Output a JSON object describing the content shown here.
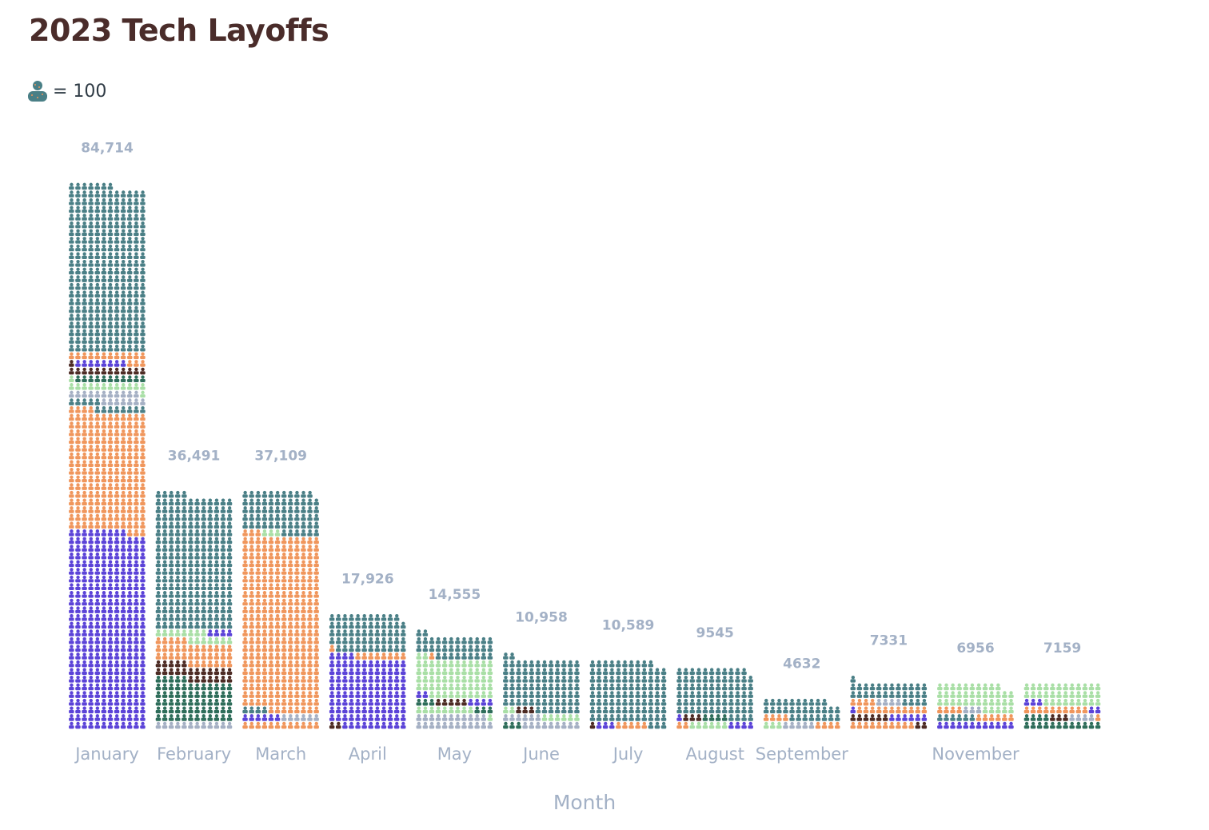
{
  "chart_data": {
    "type": "bar",
    "subtype": "isotype-stacked-pictogram",
    "title": "2023 Tech Layoffs",
    "legend": {
      "icon": "person-icon",
      "text": "= 100",
      "unit_value": 100,
      "placement": "top-left"
    },
    "xlabel": "Month",
    "ylabel": "",
    "grid": false,
    "tick_labels": [
      "January",
      "February",
      "March",
      "April",
      "May",
      "June",
      "July",
      "August",
      "September",
      "",
      "November",
      ""
    ],
    "values": [
      84714,
      36491,
      37109,
      17926,
      14555,
      10958,
      10589,
      9545,
      4632,
      7331,
      6956,
      7159
    ],
    "value_labels": [
      "84,714",
      "36,491",
      "37,109",
      "17,926",
      "14,555",
      "10,958",
      "10,589",
      "9545",
      "4632",
      "7331",
      "6956",
      "7159"
    ],
    "colors": {
      "teal": "#4a7f86",
      "orange": "#f0965c",
      "purple": "#5b43d8",
      "green": "#a9dfa6",
      "gray": "#a5b0c4",
      "brown": "#4d2b24",
      "darkgreen": "#2e6d5a"
    },
    "segments": [
      [
        [
          "purple",
          30900
        ],
        [
          "orange",
          18700
        ],
        [
          "teal",
          1300
        ],
        [
          "gray",
          1800
        ],
        [
          "green",
          1400
        ],
        [
          "darkgreen",
          1100
        ],
        [
          "brown",
          1300
        ],
        [
          "purple",
          800
        ],
        [
          "orange",
          1500
        ],
        [
          "teal",
          25914
        ]
      ],
      [
        [
          "gray",
          1200
        ],
        [
          "darkgreen",
          6500
        ],
        [
          "brown",
          2400
        ],
        [
          "orange",
          3600
        ],
        [
          "green",
          1500
        ],
        [
          "purple",
          400
        ],
        [
          "teal",
          20891
        ]
      ],
      [
        [
          "orange",
          1200
        ],
        [
          "purple",
          600
        ],
        [
          "gray",
          600
        ],
        [
          "teal",
          400
        ],
        [
          "orange",
          27500
        ],
        [
          "green",
          300
        ],
        [
          "teal",
          6509
        ]
      ],
      [
        [
          "brown",
          200
        ],
        [
          "purple",
          11000
        ],
        [
          "orange",
          900
        ],
        [
          "teal",
          5826
        ]
      ],
      [
        [
          "gray",
          2300
        ],
        [
          "green",
          1000
        ],
        [
          "darkgreen",
          600
        ],
        [
          "brown",
          500
        ],
        [
          "purple",
          600
        ],
        [
          "green",
          6000
        ],
        [
          "orange",
          100
        ],
        [
          "teal",
          3455
        ]
      ],
      [
        [
          "darkgreen",
          300
        ],
        [
          "gray",
          1500
        ],
        [
          "green",
          800
        ],
        [
          "brown",
          300
        ],
        [
          "teal",
          8058
        ]
      ],
      [
        [
          "brown",
          100
        ],
        [
          "purple",
          300
        ],
        [
          "orange",
          500
        ],
        [
          "teal",
          9689
        ]
      ],
      [
        [
          "orange",
          200
        ],
        [
          "green",
          600
        ],
        [
          "purple",
          500
        ],
        [
          "brown",
          300
        ],
        [
          "darkgreen",
          400
        ],
        [
          "teal",
          7545
        ]
      ],
      [
        [
          "green",
          300
        ],
        [
          "gray",
          500
        ],
        [
          "orange",
          800
        ],
        [
          "teal",
          3032
        ]
      ],
      [
        [
          "orange",
          1000
        ],
        [
          "brown",
          800
        ],
        [
          "purple",
          700
        ],
        [
          "orange",
          1500
        ],
        [
          "gray",
          400
        ],
        [
          "teal",
          2931
        ]
      ],
      [
        [
          "purple",
          1200
        ],
        [
          "teal",
          600
        ],
        [
          "orange",
          1000
        ],
        [
          "gray",
          300
        ],
        [
          "green",
          3856
        ]
      ],
      [
        [
          "darkgreen",
          1600
        ],
        [
          "brown",
          300
        ],
        [
          "gray",
          400
        ],
        [
          "orange",
          1100
        ],
        [
          "purple",
          500
        ],
        [
          "green",
          3259
        ]
      ]
    ]
  }
}
